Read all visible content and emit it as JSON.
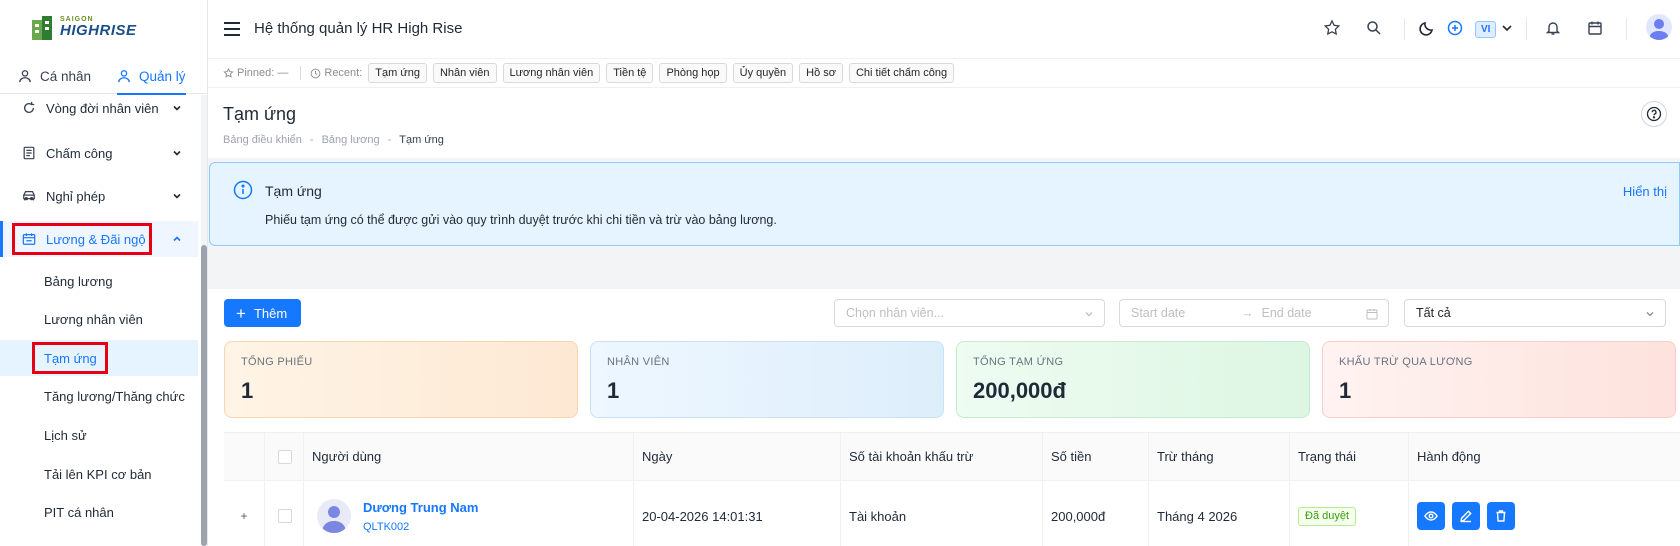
{
  "brand": {
    "line1": "SAIGON",
    "line2": "HIGHRISE"
  },
  "modes": {
    "personal": "Cá nhân",
    "manage": "Quản lý"
  },
  "sidebar": {
    "items": [
      {
        "label": "Vòng đời nhân viên",
        "icon": "cycle-icon"
      },
      {
        "label": "Chấm công",
        "icon": "document-icon"
      },
      {
        "label": "Nghỉ phép",
        "icon": "car-icon"
      },
      {
        "label": "Lương & Đãi ngộ",
        "icon": "calendar-money-icon"
      }
    ],
    "subitems": [
      "Bảng lương",
      "Lương nhân viên",
      "Tạm ứng",
      "Tăng lương/Thăng chức",
      "Lịch sử",
      "Tải lên KPI cơ bản",
      "PIT cá nhân"
    ]
  },
  "header": {
    "title": "Hệ thống quản lý HR High Rise",
    "lang": "VI"
  },
  "recent": {
    "pinned_label": "Pinned:",
    "pinned_value": "—",
    "recent_label": "Recent:",
    "chips": [
      "Tạm ứng",
      "Nhân viên",
      "Lương nhân viên",
      "Tiền tệ",
      "Phòng họp",
      "Ủy quyền",
      "Hồ sơ",
      "Chi tiết chấm công"
    ]
  },
  "page": {
    "title": "Tạm ứng",
    "breadcrumb": [
      "Bảng điều khiển",
      "-",
      "Bảng lương",
      "-",
      "Tạm ứng"
    ]
  },
  "info": {
    "title": "Tạm ứng",
    "desc": "Phiếu tạm ứng có thể được gửi vào quy trình duyệt trước khi chi tiền và trừ vào bảng lương.",
    "link": "Hiển thị"
  },
  "toolbar": {
    "add_label": "Thêm",
    "employee_placeholder": "Chọn nhân viên...",
    "start_date": "Start date",
    "end_date": "End date",
    "status_value": "Tất cả"
  },
  "stats": [
    {
      "label": "TỔNG PHIẾU",
      "value": "1"
    },
    {
      "label": "NHÂN VIÊN",
      "value": "1"
    },
    {
      "label": "TỔNG TẠM ỨNG",
      "value": "200,000đ"
    },
    {
      "label": "KHẤU TRỪ QUA LƯƠNG",
      "value": "1"
    }
  ],
  "table": {
    "headers": [
      "Người dùng",
      "Ngày",
      "Số tài khoản khấu trừ",
      "Số tiền",
      "Trừ tháng",
      "Trạng thái",
      "Hành động"
    ],
    "rows": [
      {
        "expand": "+",
        "name": "Dương Trung Nam",
        "code": "QLTK002",
        "date": "20-04-2026 14:01:31",
        "account": "Tài khoản",
        "amount": "200,000đ",
        "month": "Tháng 4 2026",
        "status": "Đã duyệt"
      }
    ]
  },
  "colors": {
    "accent": "#1677ff",
    "highlight": "#e60012"
  }
}
